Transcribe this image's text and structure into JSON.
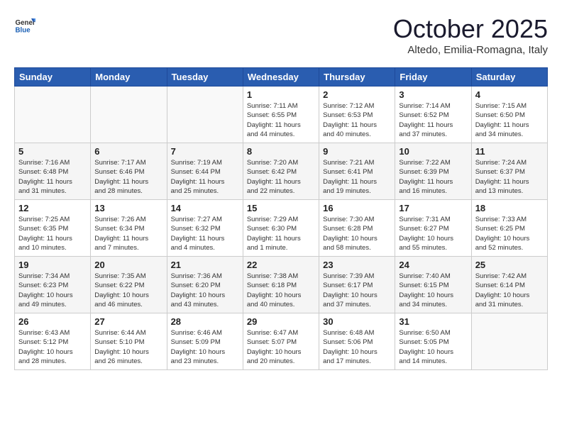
{
  "logo": {
    "general": "General",
    "blue": "Blue"
  },
  "header": {
    "month": "October 2025",
    "location": "Altedo, Emilia-Romagna, Italy"
  },
  "days_of_week": [
    "Sunday",
    "Monday",
    "Tuesday",
    "Wednesday",
    "Thursday",
    "Friday",
    "Saturday"
  ],
  "weeks": [
    [
      {
        "day": "",
        "info": ""
      },
      {
        "day": "",
        "info": ""
      },
      {
        "day": "",
        "info": ""
      },
      {
        "day": "1",
        "info": "Sunrise: 7:11 AM\nSunset: 6:55 PM\nDaylight: 11 hours\nand 44 minutes."
      },
      {
        "day": "2",
        "info": "Sunrise: 7:12 AM\nSunset: 6:53 PM\nDaylight: 11 hours\nand 40 minutes."
      },
      {
        "day": "3",
        "info": "Sunrise: 7:14 AM\nSunset: 6:52 PM\nDaylight: 11 hours\nand 37 minutes."
      },
      {
        "day": "4",
        "info": "Sunrise: 7:15 AM\nSunset: 6:50 PM\nDaylight: 11 hours\nand 34 minutes."
      }
    ],
    [
      {
        "day": "5",
        "info": "Sunrise: 7:16 AM\nSunset: 6:48 PM\nDaylight: 11 hours\nand 31 minutes."
      },
      {
        "day": "6",
        "info": "Sunrise: 7:17 AM\nSunset: 6:46 PM\nDaylight: 11 hours\nand 28 minutes."
      },
      {
        "day": "7",
        "info": "Sunrise: 7:19 AM\nSunset: 6:44 PM\nDaylight: 11 hours\nand 25 minutes."
      },
      {
        "day": "8",
        "info": "Sunrise: 7:20 AM\nSunset: 6:42 PM\nDaylight: 11 hours\nand 22 minutes."
      },
      {
        "day": "9",
        "info": "Sunrise: 7:21 AM\nSunset: 6:41 PM\nDaylight: 11 hours\nand 19 minutes."
      },
      {
        "day": "10",
        "info": "Sunrise: 7:22 AM\nSunset: 6:39 PM\nDaylight: 11 hours\nand 16 minutes."
      },
      {
        "day": "11",
        "info": "Sunrise: 7:24 AM\nSunset: 6:37 PM\nDaylight: 11 hours\nand 13 minutes."
      }
    ],
    [
      {
        "day": "12",
        "info": "Sunrise: 7:25 AM\nSunset: 6:35 PM\nDaylight: 11 hours\nand 10 minutes."
      },
      {
        "day": "13",
        "info": "Sunrise: 7:26 AM\nSunset: 6:34 PM\nDaylight: 11 hours\nand 7 minutes."
      },
      {
        "day": "14",
        "info": "Sunrise: 7:27 AM\nSunset: 6:32 PM\nDaylight: 11 hours\nand 4 minutes."
      },
      {
        "day": "15",
        "info": "Sunrise: 7:29 AM\nSunset: 6:30 PM\nDaylight: 11 hours\nand 1 minute."
      },
      {
        "day": "16",
        "info": "Sunrise: 7:30 AM\nSunset: 6:28 PM\nDaylight: 10 hours\nand 58 minutes."
      },
      {
        "day": "17",
        "info": "Sunrise: 7:31 AM\nSunset: 6:27 PM\nDaylight: 10 hours\nand 55 minutes."
      },
      {
        "day": "18",
        "info": "Sunrise: 7:33 AM\nSunset: 6:25 PM\nDaylight: 10 hours\nand 52 minutes."
      }
    ],
    [
      {
        "day": "19",
        "info": "Sunrise: 7:34 AM\nSunset: 6:23 PM\nDaylight: 10 hours\nand 49 minutes."
      },
      {
        "day": "20",
        "info": "Sunrise: 7:35 AM\nSunset: 6:22 PM\nDaylight: 10 hours\nand 46 minutes."
      },
      {
        "day": "21",
        "info": "Sunrise: 7:36 AM\nSunset: 6:20 PM\nDaylight: 10 hours\nand 43 minutes."
      },
      {
        "day": "22",
        "info": "Sunrise: 7:38 AM\nSunset: 6:18 PM\nDaylight: 10 hours\nand 40 minutes."
      },
      {
        "day": "23",
        "info": "Sunrise: 7:39 AM\nSunset: 6:17 PM\nDaylight: 10 hours\nand 37 minutes."
      },
      {
        "day": "24",
        "info": "Sunrise: 7:40 AM\nSunset: 6:15 PM\nDaylight: 10 hours\nand 34 minutes."
      },
      {
        "day": "25",
        "info": "Sunrise: 7:42 AM\nSunset: 6:14 PM\nDaylight: 10 hours\nand 31 minutes."
      }
    ],
    [
      {
        "day": "26",
        "info": "Sunrise: 6:43 AM\nSunset: 5:12 PM\nDaylight: 10 hours\nand 28 minutes."
      },
      {
        "day": "27",
        "info": "Sunrise: 6:44 AM\nSunset: 5:10 PM\nDaylight: 10 hours\nand 26 minutes."
      },
      {
        "day": "28",
        "info": "Sunrise: 6:46 AM\nSunset: 5:09 PM\nDaylight: 10 hours\nand 23 minutes."
      },
      {
        "day": "29",
        "info": "Sunrise: 6:47 AM\nSunset: 5:07 PM\nDaylight: 10 hours\nand 20 minutes."
      },
      {
        "day": "30",
        "info": "Sunrise: 6:48 AM\nSunset: 5:06 PM\nDaylight: 10 hours\nand 17 minutes."
      },
      {
        "day": "31",
        "info": "Sunrise: 6:50 AM\nSunset: 5:05 PM\nDaylight: 10 hours\nand 14 minutes."
      },
      {
        "day": "",
        "info": ""
      }
    ]
  ]
}
